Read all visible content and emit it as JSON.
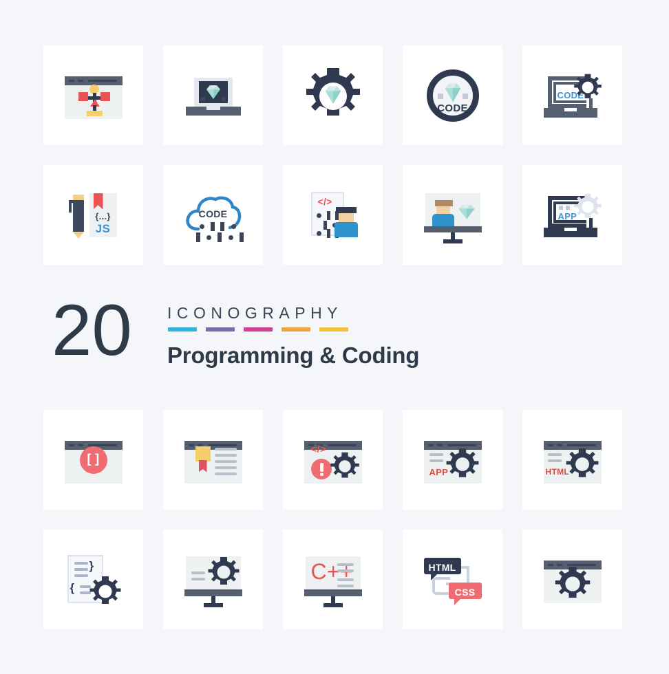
{
  "page": {
    "background_color": "#f4f6fa",
    "card_color": "#ffffff"
  },
  "title_block": {
    "count": "20",
    "eyebrow": "ICONOGRAPHY",
    "subtitle": "Programming & Coding",
    "bar_colors": [
      "#2cb5db",
      "#7a6bad",
      "#d43e92",
      "#f2a33c",
      "#f5c13d"
    ]
  },
  "palette": {
    "dark_navy": "#2f3a51",
    "slate": "#555f70",
    "screen_light": "#eef1f2",
    "mint": "#a9ddd6",
    "mint_light": "#cfeae6",
    "red": "#ea5455",
    "coral": "#ef6d72",
    "blue": "#3d9ad4",
    "blue_text": "#3f94d0",
    "yellow": "#f6cf6d",
    "gray_line": "#b9bfc9",
    "skin": "#f2d1a5",
    "shirt_blue": "#2e93cc"
  },
  "rows": [
    {
      "name": "row-1",
      "icons": [
        {
          "id": "browser-sitemap",
          "label": "browser sitemap diagram",
          "text": ""
        },
        {
          "id": "laptop-diamond",
          "label": "laptop with diamond",
          "text": ""
        },
        {
          "id": "gear-diamond",
          "label": "gear with diamond",
          "text": ""
        },
        {
          "id": "code-badge",
          "label": "circular code badge with diamond",
          "text": "CODE"
        },
        {
          "id": "laptop-code-gear",
          "label": "laptop code with gear",
          "text": "CODE"
        }
      ]
    },
    {
      "name": "row-2",
      "icons": [
        {
          "id": "pencil-js-page",
          "label": "pencil and JS bookmarked page",
          "text": "JS"
        },
        {
          "id": "cloud-code",
          "label": "cloud code with binary",
          "text": "CODE"
        },
        {
          "id": "document-developer",
          "label": "code document with graduate",
          "text": ""
        },
        {
          "id": "monitor-developer-diamond",
          "label": "monitor with developer and diamond",
          "text": ""
        },
        {
          "id": "laptop-app-gear",
          "label": "laptop app with gear",
          "text": "APP"
        }
      ]
    },
    {
      "name": "row-3",
      "icons": [
        {
          "id": "browser-brackets",
          "label": "browser with square brackets badge",
          "text": "[ ]"
        },
        {
          "id": "browser-certificate",
          "label": "browser with ribbon certificate",
          "text": ""
        },
        {
          "id": "browser-code-error-gear",
          "label": "browser code error with gear",
          "text": ""
        },
        {
          "id": "browser-app-gear",
          "label": "browser app settings",
          "text": "APP"
        },
        {
          "id": "browser-html-gear",
          "label": "browser html settings",
          "text": "HTML"
        }
      ]
    },
    {
      "name": "row-4",
      "icons": [
        {
          "id": "document-braces-gear",
          "label": "code document settings",
          "text": ""
        },
        {
          "id": "monitor-gear",
          "label": "monitor settings",
          "text": ""
        },
        {
          "id": "monitor-cpp",
          "label": "monitor with C++ code",
          "text": "C++"
        },
        {
          "id": "html-css-bubbles",
          "label": "html and css speech bubbles",
          "html_label": "HTML",
          "css_label": "CSS"
        },
        {
          "id": "browser-gear",
          "label": "browser settings gear",
          "text": ""
        }
      ]
    }
  ]
}
